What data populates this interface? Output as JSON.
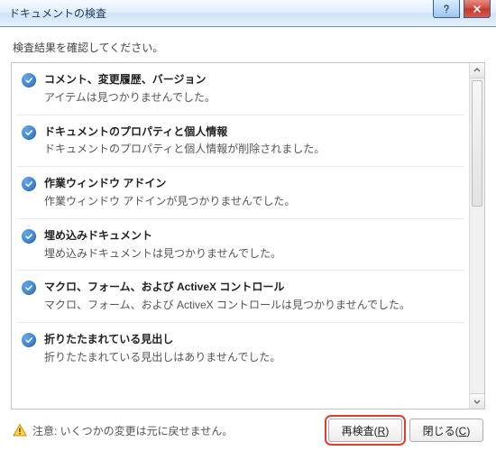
{
  "title": "ドキュメントの検査",
  "instructions": "検査結果を確認してください。",
  "results": [
    {
      "title": "コメント、変更履歴、バージョン",
      "desc": "アイテムは見つかりませんでした。"
    },
    {
      "title": "ドキュメントのプロパティと個人情報",
      "desc": "ドキュメントのプロパティと個人情報が削除されました。"
    },
    {
      "title": "作業ウィンドウ アドイン",
      "desc": "作業ウィンドウ アドインが見つかりませんでした。"
    },
    {
      "title": "埋め込みドキュメント",
      "desc": "埋め込みドキュメントは見つかりませんでした。"
    },
    {
      "title": "マクロ、フォーム、および ActiveX コントロール",
      "desc": "マクロ、フォーム、および ActiveX コントロールは見つかりませんでした。"
    },
    {
      "title": "折りたたまれている見出し",
      "desc": "折りたたまれている見出しはありませんでした。"
    }
  ],
  "warning": "注意: いくつかの変更は元に戻せません。",
  "buttons": {
    "reinspect": "再検査(R)",
    "close": "閉じる(C)"
  }
}
